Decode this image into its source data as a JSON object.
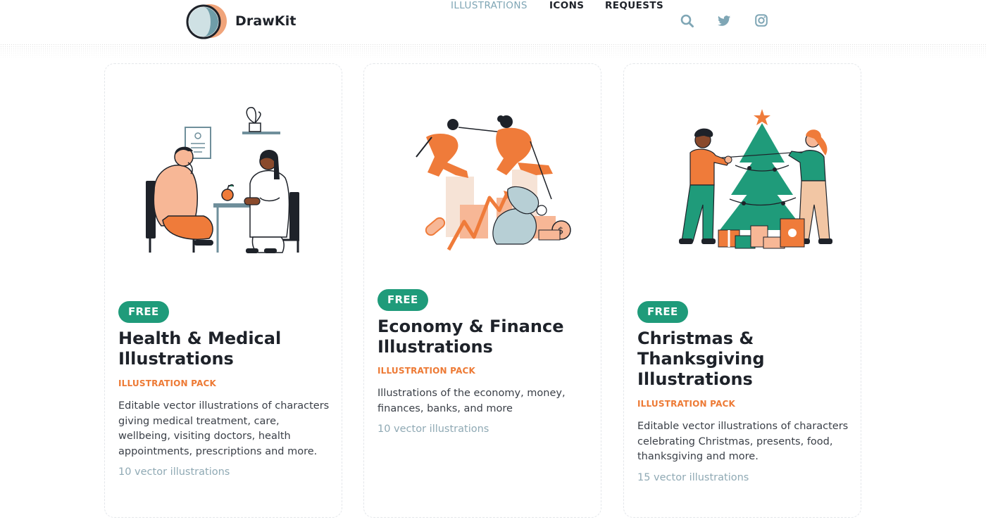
{
  "brand": {
    "name": "DrawKit"
  },
  "nav": {
    "links": [
      {
        "label": "ILLUSTRATIONS",
        "active": true
      },
      {
        "label": "ICONS",
        "active": false
      },
      {
        "label": "REQUESTS",
        "active": false
      }
    ],
    "icons": [
      "search-icon",
      "twitter-icon",
      "instagram-icon"
    ]
  },
  "colors": {
    "accent_green": "#1f9b7a",
    "accent_orange": "#ed7a35",
    "muted_blue": "#7fa6b5",
    "text_dark": "#1e2229"
  },
  "cards": [
    {
      "badge": "FREE",
      "title_lines": [
        "Health & Medical",
        "Illustrations"
      ],
      "label": "ILLUSTRATION PACK",
      "description": "Editable vector illustrations of characters giving medical treatment, care, wellbeing, visiting doctors, health appointments, prescriptions and more.",
      "count": "10 vector illustrations",
      "illustration": "health-medical-illustration"
    },
    {
      "badge": "FREE",
      "title_lines": [
        "Economy & Finance",
        "Illustrations"
      ],
      "label": "ILLUSTRATION PACK",
      "description": "Illustrations of the economy, money, finances, banks, and more",
      "count": "10 vector illustrations",
      "illustration": "economy-finance-illustration"
    },
    {
      "badge": "FREE",
      "title_lines": [
        "Christmas &",
        "Thanksgiving",
        "Illustrations"
      ],
      "label": "ILLUSTRATION PACK",
      "description": "Editable vector illustrations of characters celebrating Christmas, presents, food, thanksgiving and more.",
      "count": "15 vector illustrations",
      "illustration": "christmas-thanksgiving-illustration"
    }
  ]
}
